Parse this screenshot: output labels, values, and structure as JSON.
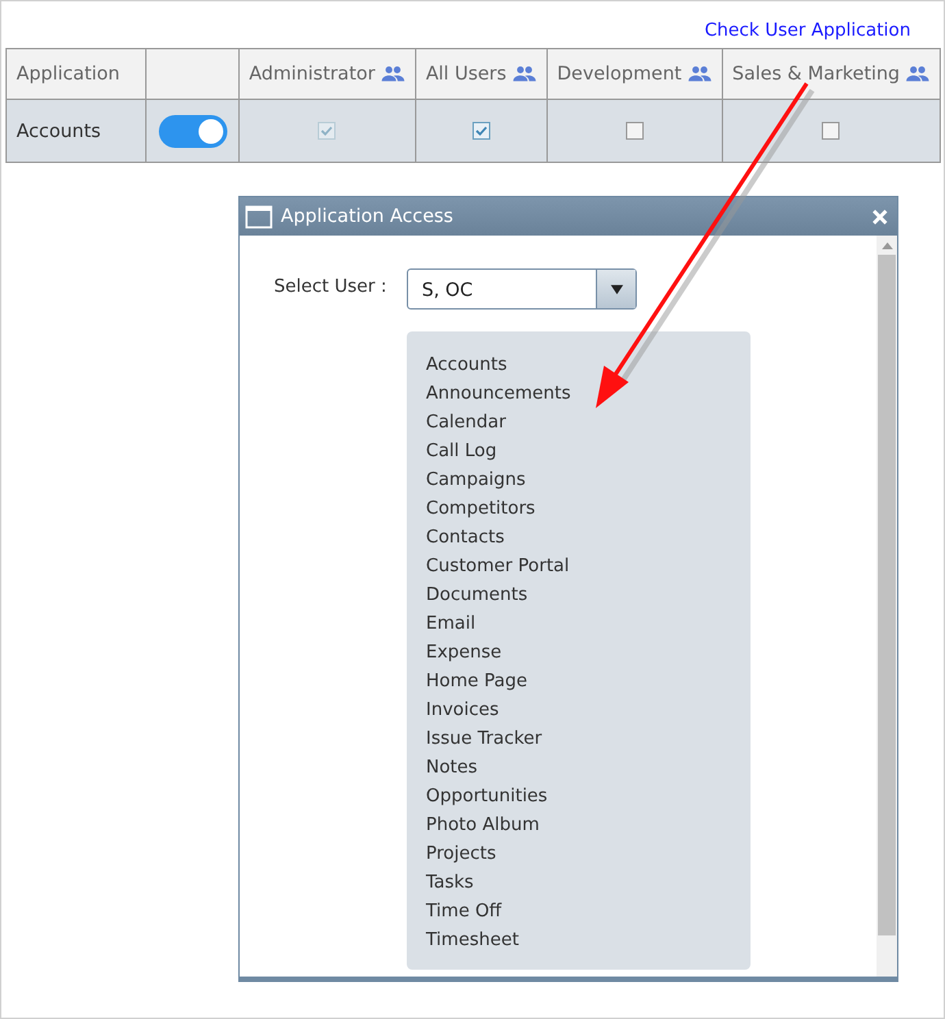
{
  "link": {
    "text": "Check User Application"
  },
  "table": {
    "application_header": "Application",
    "groups": [
      "Administrator",
      "All Users",
      "Development",
      "Sales & Marketing"
    ],
    "rows": [
      {
        "name": "Accounts",
        "enabled": true,
        "access": [
          {
            "checked": true,
            "disabled": true
          },
          {
            "checked": true,
            "disabled": false
          },
          {
            "checked": false,
            "disabled": false
          },
          {
            "checked": false,
            "disabled": false
          }
        ]
      }
    ]
  },
  "dialog": {
    "title": "Application Access",
    "select_user": {
      "label": "Select User :",
      "value": "S, OC"
    },
    "applications": [
      "Accounts",
      "Announcements",
      "Calendar",
      "Call Log",
      "Campaigns",
      "Competitors",
      "Contacts",
      "Customer Portal",
      "Documents",
      "Email",
      "Expense",
      "Home Page",
      "Invoices",
      "Issue Tracker",
      "Notes",
      "Opportunities",
      "Photo Album",
      "Projects",
      "Tasks",
      "Time Off",
      "Timesheet"
    ]
  }
}
